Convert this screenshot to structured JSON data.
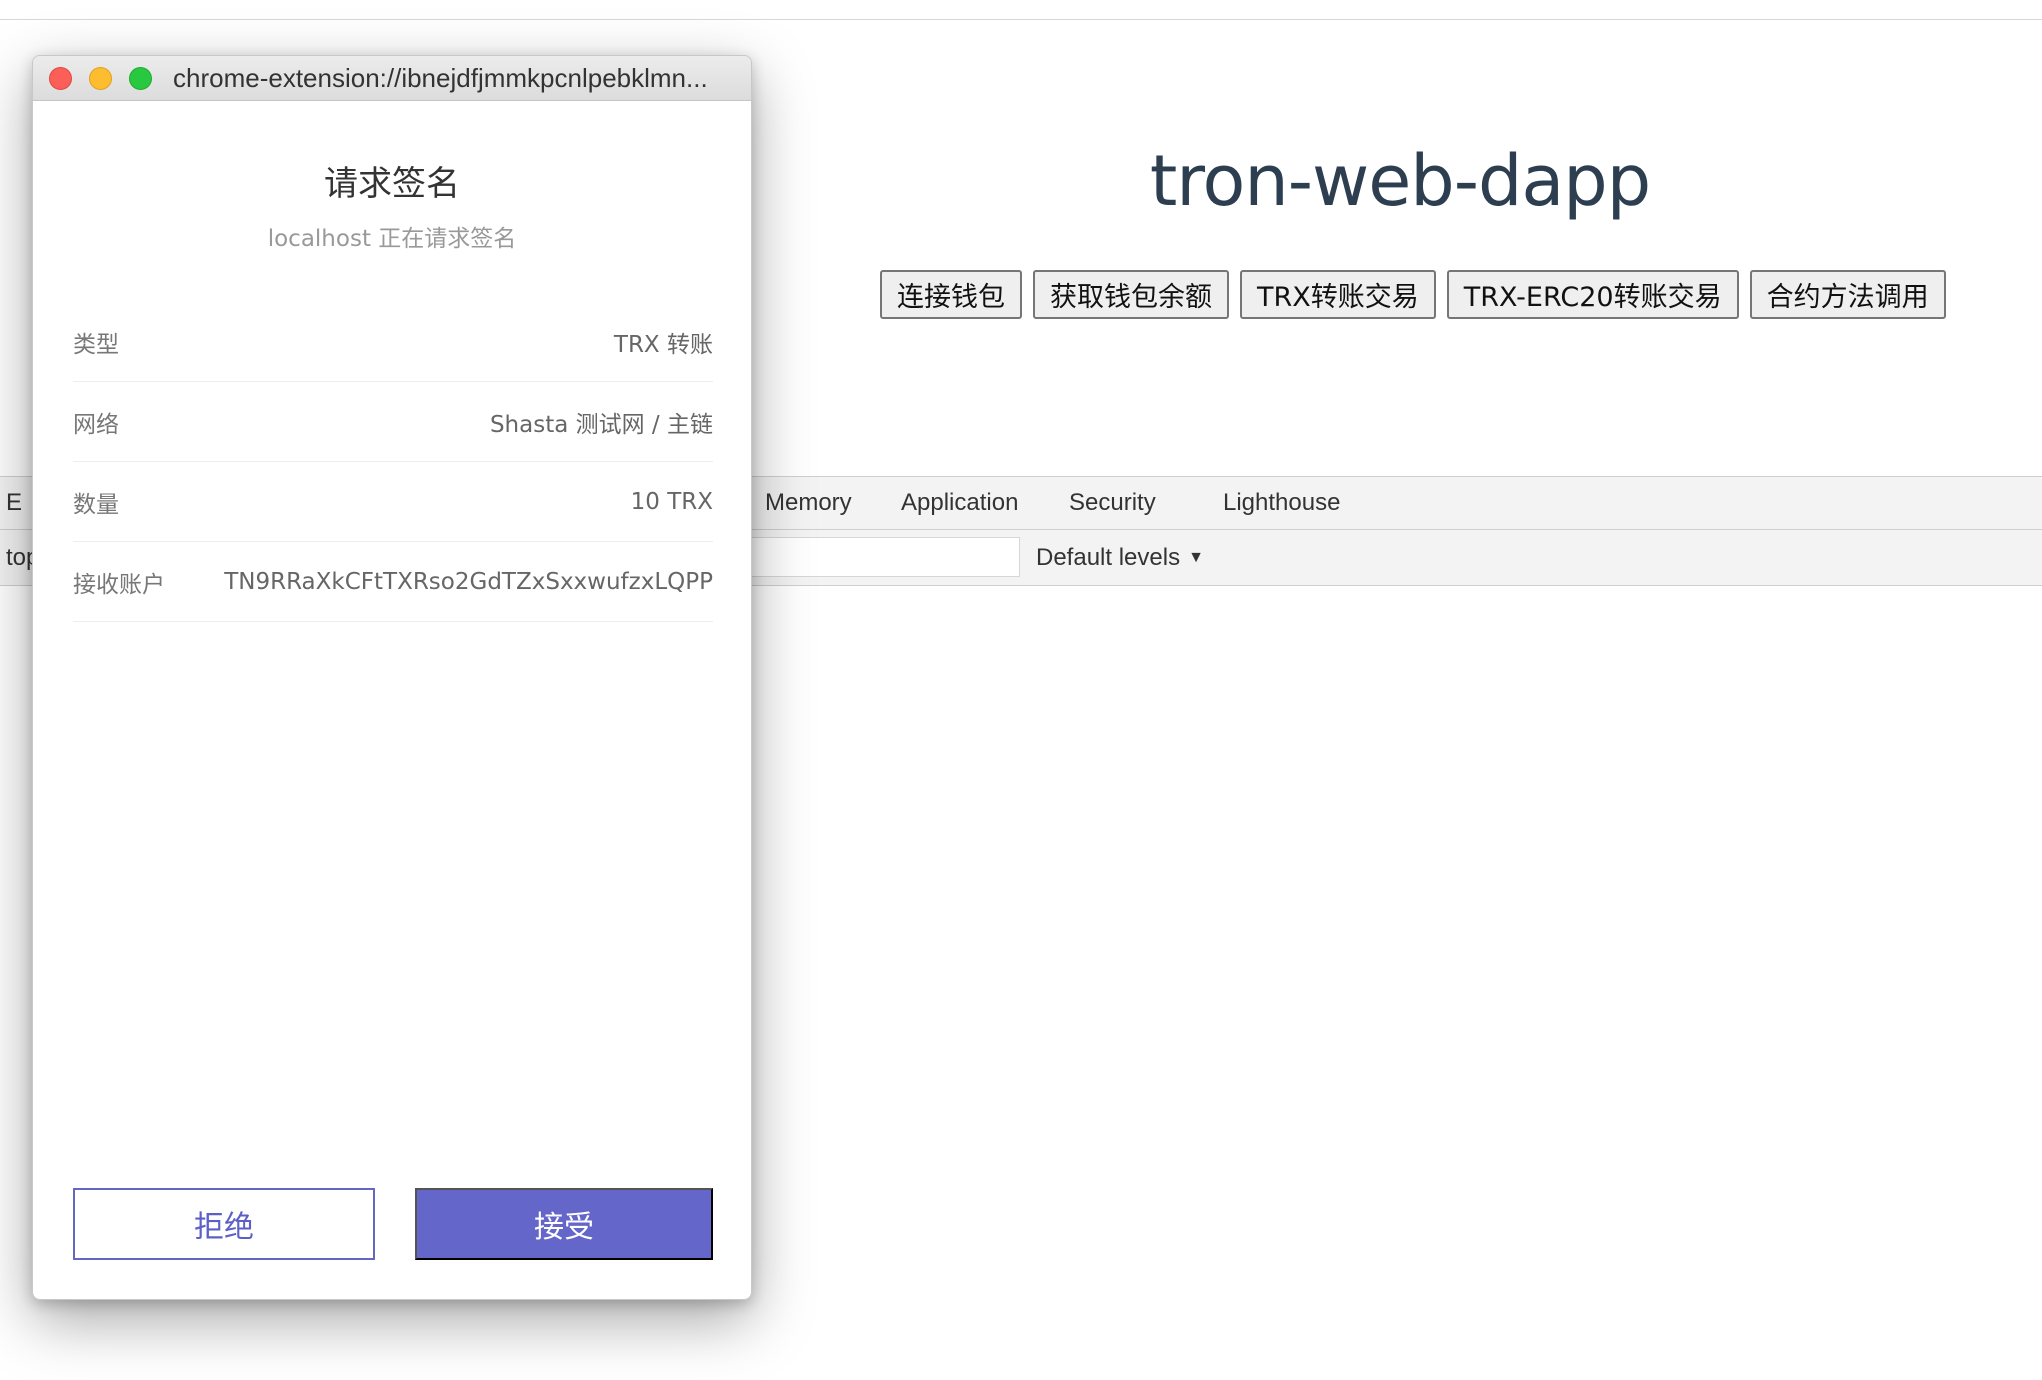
{
  "dapp": {
    "title": "tron-web-dapp",
    "buttons": [
      "连接钱包",
      "获取钱包余额",
      "TRX转账交易",
      "TRX-ERC20转账交易",
      "合约方法调用"
    ]
  },
  "devtools": {
    "tabs": [
      "Memory",
      "Application",
      "Security",
      "Lighthouse"
    ],
    "left_tab_fragment": "E",
    "context_fragment": "top",
    "levels_label": "Default levels",
    "levels_caret": "▼"
  },
  "popup": {
    "url": "chrome-extension://ibnejdfjmmkpcnlpebklmn...",
    "title": "请求签名",
    "subtitle": "localhost 正在请求签名",
    "rows": [
      {
        "label": "类型",
        "value": "TRX 转账"
      },
      {
        "label": "网络",
        "value": "Shasta 测试网 / 主链"
      },
      {
        "label": "数量",
        "value": "10 TRX"
      },
      {
        "label": "接收账户",
        "value": "TN9RRaXkCFtTXRso2GdTZxSxxwufzxLQPP"
      }
    ],
    "reject_label": "拒绝",
    "accept_label": "接受"
  }
}
